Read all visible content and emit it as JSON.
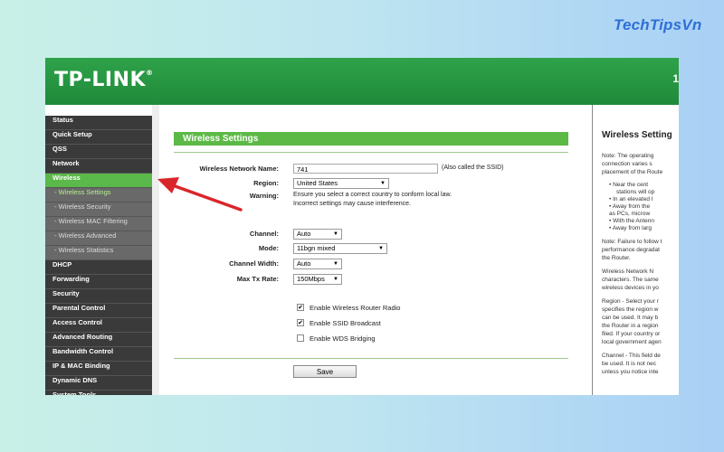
{
  "watermark": "TechTipsVn",
  "header": {
    "logo": "TP-LINK",
    "logo_mark": "®",
    "right_text": "1",
    "right_sub": ""
  },
  "sidebar": {
    "items": [
      {
        "label": "Status",
        "type": "main"
      },
      {
        "label": "Quick Setup",
        "type": "main"
      },
      {
        "label": "QSS",
        "type": "main"
      },
      {
        "label": "Network",
        "type": "main"
      },
      {
        "label": "Wireless",
        "type": "active"
      },
      {
        "label": "- Wireless Settings",
        "type": "sub-selected"
      },
      {
        "label": "- Wireless Security",
        "type": "sub"
      },
      {
        "label": "- Wireless MAC Filtering",
        "type": "sub"
      },
      {
        "label": "- Wireless Advanced",
        "type": "sub"
      },
      {
        "label": "- Wireless Statistics",
        "type": "sub"
      },
      {
        "label": "DHCP",
        "type": "main"
      },
      {
        "label": "Forwarding",
        "type": "main"
      },
      {
        "label": "Security",
        "type": "main"
      },
      {
        "label": "Parental Control",
        "type": "main"
      },
      {
        "label": "Access Control",
        "type": "main"
      },
      {
        "label": "Advanced Routing",
        "type": "main"
      },
      {
        "label": "Bandwidth Control",
        "type": "main"
      },
      {
        "label": "IP & MAC Binding",
        "type": "main"
      },
      {
        "label": "Dynamic DNS",
        "type": "main"
      },
      {
        "label": "System Tools",
        "type": "main"
      }
    ]
  },
  "form": {
    "section_title": "Wireless Settings",
    "network_name_label": "Wireless Network Name:",
    "network_name_value": "741",
    "network_name_hint": "(Also called the SSID)",
    "region_label": "Region:",
    "region_value": "United States",
    "warning_label": "Warning:",
    "warning_line1": "Ensure you select a correct country to conform local law.",
    "warning_line2": "Incorrect settings may cause interference.",
    "channel_label": "Channel:",
    "channel_value": "Auto",
    "mode_label": "Mode:",
    "mode_value": "11bgn mixed",
    "width_label": "Channel Width:",
    "width_value": "Auto",
    "rate_label": "Max Tx Rate:",
    "rate_value": "150Mbps",
    "cb_radio_label": "Enable Wireless Router Radio",
    "cb_radio_checked": true,
    "cb_ssid_label": "Enable SSID Broadcast",
    "cb_ssid_checked": true,
    "cb_wds_label": "Enable WDS Bridging",
    "cb_wds_checked": false,
    "save_label": "Save"
  },
  "help": {
    "title": "Wireless Setting",
    "note1_lines": [
      "Note: The operating",
      "connection varies s",
      "placement of the Route"
    ],
    "bullets": [
      "Near the cent",
      "stations will op",
      "In an elevated l",
      "Away from the",
      "as PCs, microw",
      "With the Antenn",
      "Away from larg"
    ],
    "note2_lines": [
      "Note: Failure to follow t",
      "performance degradat",
      "the Router."
    ],
    "para1_lines": [
      "Wireless Network N",
      "characters. The same",
      "wireless devices in yo"
    ],
    "para2_lines": [
      "Region - Select your r",
      "specifies the region w",
      "can be used. It may b",
      "the Router in a region",
      "filed. If your country or",
      "local government agen"
    ],
    "para3_lines": [
      "Channel - This field de",
      "be used. It is not nec",
      "unless you notice inte"
    ]
  },
  "colors": {
    "header_green": "#1f8a3a",
    "active_green": "#5bb84a",
    "sidebar_dark": "#3a3a3a",
    "arrow_red": "#d9262b"
  }
}
